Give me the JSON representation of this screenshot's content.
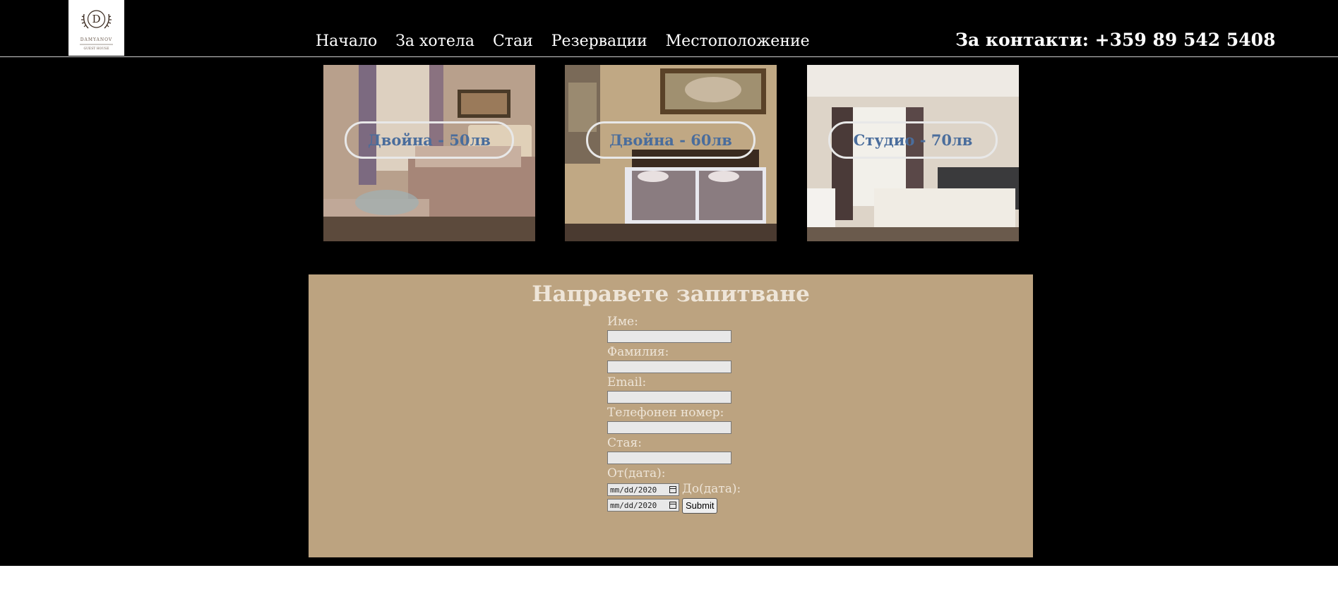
{
  "header": {
    "logo": {
      "initial": "D",
      "name": "DAMYANOV",
      "tagline": "GUEST HOUSE"
    },
    "nav": [
      "Начало",
      "За хотела",
      "Стаи",
      "Резервации",
      "Местоположение"
    ],
    "contact": "За контакти: +359 89 542 5408"
  },
  "rooms": [
    {
      "label": "Двойна - 50лв"
    },
    {
      "label": "Двойна - 60лв"
    },
    {
      "label": "Студио - 70лв"
    }
  ],
  "form": {
    "title": "Направете запитване",
    "first_name_label": "Име:",
    "last_name_label": "Фамилия:",
    "email_label": "Email:",
    "phone_label": "Телефонен номер:",
    "room_label": "Стая:",
    "from_label": "От(дата):",
    "to_label": "До(дата):",
    "date_placeholder": "mm/dd/2020",
    "submit_label": "Submit"
  },
  "colors": {
    "background": "#000000",
    "form_panel": "#bca380",
    "form_text": "#eee5d8",
    "room_label": "#4a6d9c",
    "nav_text": "#ffffff"
  },
  "icons": [
    "laurel-logo-icon",
    "calendar-icon"
  ]
}
